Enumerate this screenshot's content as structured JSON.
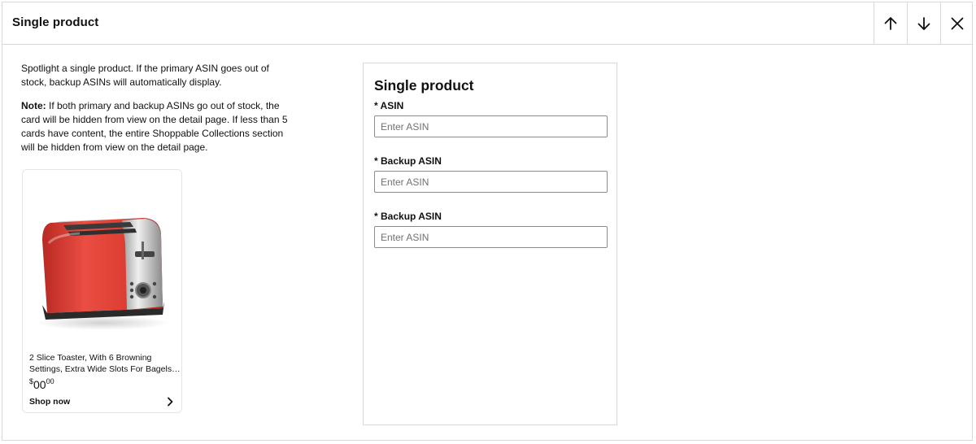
{
  "header": {
    "title": "Single product",
    "move_up_icon": "arrow-up-icon",
    "move_down_icon": "arrow-down-icon",
    "close_icon": "close-icon"
  },
  "description": {
    "intro": "Spotlight a single product. If the primary ASIN goes out of stock, backup ASINs will automatically display.",
    "note_label": "Note:",
    "note_text": " If both primary and backup ASINs go out of stock, the card will be hidden from view on the detail page. If less than 5 cards have content, the entire Shoppable Collections section will be hidden from view on the detail page."
  },
  "preview_card": {
    "image": "toaster-image",
    "product_title": "2 Slice Toaster, With 6 Browning Settings, Extra Wide Slots For Bagels…",
    "price_symbol": "$",
    "price_whole": "00",
    "price_fraction": "00",
    "cta": "Shop now",
    "cta_icon": "chevron-right-icon"
  },
  "form": {
    "title": "Single product",
    "fields": [
      {
        "label": "* ASIN",
        "placeholder": "Enter ASIN",
        "value": ""
      },
      {
        "label": "* Backup ASIN",
        "placeholder": "Enter ASIN",
        "value": ""
      },
      {
        "label": "* Backup ASIN",
        "placeholder": "Enter ASIN",
        "value": ""
      }
    ]
  },
  "colors": {
    "border": "#d5d9d9",
    "text": "#0f1111",
    "toaster_red": "#e2453b"
  }
}
